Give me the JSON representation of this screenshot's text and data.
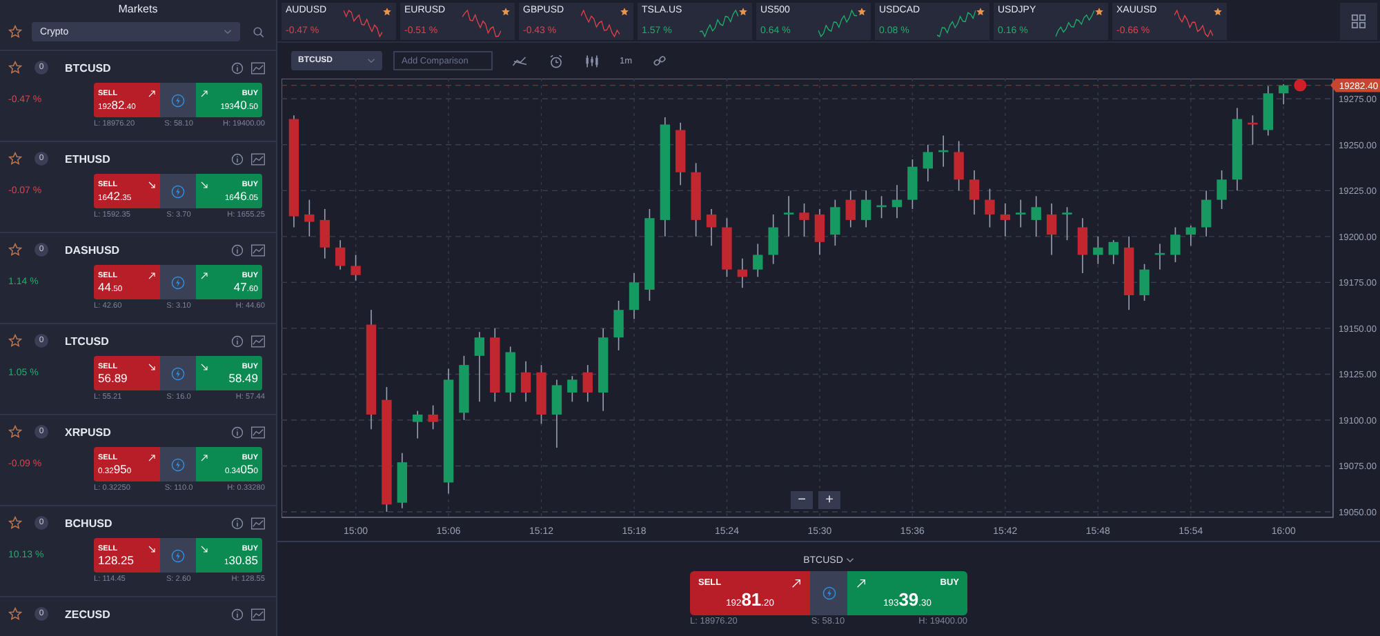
{
  "sidebar": {
    "title": "Markets",
    "filter": "Crypto",
    "markets": [
      {
        "name": "BTCUSD",
        "badge": "0",
        "change": "-0.47 %",
        "color": "#e0414a",
        "kind": "rising",
        "sell_label": "SELL",
        "buy_label": "BUY",
        "sell": {
          "pre": "192",
          "big": "82",
          "post": ".40"
        },
        "buy": {
          "pre": "193",
          "big": "40",
          "post": ".50"
        },
        "low": "L: 18976.20",
        "spread": "S: 58.10",
        "high": "H: 19400.00"
      },
      {
        "name": "ETHUSD",
        "badge": "0",
        "change": "-0.07 %",
        "color": "#e0414a",
        "kind": "falling",
        "sell_label": "SELL",
        "buy_label": "BUY",
        "sell": {
          "pre": "16",
          "big": "42",
          "post": ".35"
        },
        "buy": {
          "pre": "16",
          "big": "46",
          "post": ".05"
        },
        "low": "L: 1592.35",
        "spread": "S: 3.70",
        "high": "H: 1655.25"
      },
      {
        "name": "DASHUSD",
        "badge": "0",
        "change": "1.14 %",
        "color": "#1fae6b",
        "kind": "rising",
        "sell_label": "SELL",
        "buy_label": "BUY",
        "sell": {
          "big": "44",
          "post": ".50"
        },
        "buy": {
          "big": "47",
          "post": ".60"
        },
        "low": "L: 42.60",
        "spread": "S: 3.10",
        "high": "H: 44.60"
      },
      {
        "name": "LTCUSD",
        "badge": "0",
        "change": "1.05 %",
        "color": "#1fae6b",
        "kind": "falling",
        "sell_label": "SELL",
        "buy_label": "BUY",
        "sell": {
          "big": "56.89"
        },
        "buy": {
          "big": "58.49"
        },
        "low": "L: 55.21",
        "spread": "S: 16.0",
        "high": "H: 57.44"
      },
      {
        "name": "XRPUSD",
        "badge": "0",
        "change": "-0.09 %",
        "color": "#e0414a",
        "kind": "rising",
        "sell_label": "SELL",
        "buy_label": "BUY",
        "sell": {
          "pre": "0.32",
          "big": "95",
          "post": "0"
        },
        "buy": {
          "pre": "0.34",
          "big": "05",
          "post": "0"
        },
        "low": "L: 0.32250",
        "spread": "S: 110.0",
        "high": "H: 0.33280"
      },
      {
        "name": "BCHUSD",
        "badge": "0",
        "change": "10.13 %",
        "color": "#1fae6b",
        "kind": "falling",
        "sell_label": "SELL",
        "buy_label": "BUY",
        "sell": {
          "big": "128.25"
        },
        "buy": {
          "pre": "1",
          "big": "30.85"
        },
        "low": "L: 114.45",
        "spread": "S: 2.60",
        "high": "H: 128.55"
      },
      {
        "name": "ZECUSD",
        "badge": "0"
      }
    ]
  },
  "tickers": [
    {
      "name": "AUDUSD",
      "change": "-0.47 %",
      "color": "#e0414a",
      "kind": "falling"
    },
    {
      "name": "EURUSD",
      "change": "-0.51 %",
      "color": "#e0414a",
      "kind": "falling"
    },
    {
      "name": "GBPUSD",
      "change": "-0.43 %",
      "color": "#e0414a",
      "kind": "falling"
    },
    {
      "name": "TSLA.US",
      "change": "1.57 %",
      "color": "#1fae6b",
      "kind": "rising"
    },
    {
      "name": "US500",
      "change": "0.64 %",
      "color": "#1fae6b",
      "kind": "rising"
    },
    {
      "name": "USDCAD",
      "change": "0.08 %",
      "color": "#1fae6b",
      "kind": "rising"
    },
    {
      "name": "USDJPY",
      "change": "0.16 %",
      "color": "#1fae6b",
      "kind": "rising"
    },
    {
      "name": "XAUUSD",
      "change": "-0.66 %",
      "color": "#e0414a",
      "kind": "falling"
    }
  ],
  "toolbar": {
    "symbol": "BTCUSD",
    "comparison_placeholder": "Add Comparison",
    "interval": "1m"
  },
  "chart": {
    "zoom_controls": [
      "−",
      "+"
    ],
    "chart_data": {
      "type": "candlestick",
      "grid": true,
      "categories": [
        null,
        null,
        null,
        null,
        "15:00",
        null,
        null,
        null,
        null,
        null,
        "15:06",
        null,
        null,
        null,
        null,
        null,
        "15:12",
        null,
        null,
        null,
        null,
        null,
        "15:18",
        null,
        null,
        null,
        null,
        null,
        "15:24",
        null,
        null,
        null,
        null,
        null,
        "15:30",
        null,
        null,
        null,
        null,
        null,
        "15:36",
        null,
        null,
        null,
        null,
        null,
        "15:42",
        null,
        null,
        null,
        null,
        null,
        "15:48",
        null,
        null,
        null,
        null,
        null,
        "15:54",
        null,
        null,
        null,
        null,
        null,
        "16:00"
      ],
      "ylim": [
        19047,
        19286
      ],
      "yticks": [
        {
          "value": 19050,
          "label": "19050.00"
        },
        {
          "value": 19075,
          "label": "19075.00"
        },
        {
          "value": 19100,
          "label": "19100.00"
        },
        {
          "value": 19125,
          "label": "19125.00"
        },
        {
          "value": 19150,
          "label": "19150.00"
        },
        {
          "value": 19175,
          "label": "19175.00"
        },
        {
          "value": 19200,
          "label": "19200.00"
        },
        {
          "value": 19225,
          "label": "19225.00"
        },
        {
          "value": 19250,
          "label": "19250.00"
        },
        {
          "value": 19275,
          "label": "19275.00"
        }
      ],
      "ref_lines": [
        {
          "axis": "y",
          "value": 19282.4,
          "label": "19282.40"
        }
      ],
      "series": [
        {
          "ohlc": [
            [
              19264,
              19266,
              19205,
              19211
            ],
            [
              19212,
              19220,
              19200,
              19208
            ],
            [
              19209,
              19215,
              19188,
              19194
            ],
            [
              19194,
              19198,
              19182,
              19184
            ],
            [
              19184,
              19190,
              19176,
              19179
            ],
            [
              19152,
              19160,
              19095,
              19103
            ],
            [
              19111,
              19118,
              19050,
              19054
            ],
            [
              19055,
              19082,
              19052,
              19077
            ],
            [
              19099,
              19105,
              19090,
              19103
            ],
            [
              19103,
              19108,
              19095,
              19099
            ],
            [
              19066,
              19128,
              19060,
              19122
            ],
            [
              19104,
              19135,
              19100,
              19130
            ],
            [
              19135,
              19148,
              19110,
              19145
            ],
            [
              19145,
              19150,
              19110,
              19115
            ],
            [
              19115,
              19140,
              19110,
              19137
            ],
            [
              19126,
              19132,
              19110,
              19115
            ],
            [
              19126,
              19130,
              19098,
              19103
            ],
            [
              19103,
              19122,
              19085,
              19119
            ],
            [
              19115,
              19124,
              19110,
              19122
            ],
            [
              19126,
              19130,
              19110,
              19115
            ],
            [
              19115,
              19150,
              19105,
              19145
            ],
            [
              19145,
              19165,
              19138,
              19160
            ],
            [
              19160,
              19180,
              19155,
              19175
            ],
            [
              19171,
              19215,
              19165,
              19210
            ],
            [
              19209,
              19265,
              19200,
              19261
            ],
            [
              19258,
              19262,
              19228,
              19235
            ],
            [
              19235,
              19240,
              19200,
              19209
            ],
            [
              19212,
              19215,
              19195,
              19205
            ],
            [
              19205,
              19210,
              19178,
              19182
            ],
            [
              19182,
              19188,
              19172,
              19178
            ],
            [
              19182,
              19196,
              19178,
              19190
            ],
            [
              19190,
              19212,
              19185,
              19205
            ],
            [
              19212,
              19222,
              19200,
              19213
            ],
            [
              19213,
              19218,
              19200,
              19209
            ],
            [
              19212,
              19215,
              19190,
              19197
            ],
            [
              19201,
              19220,
              19195,
              19216
            ],
            [
              19220,
              19225,
              19205,
              19209
            ],
            [
              19209,
              19225,
              19205,
              19220
            ],
            [
              19216,
              19222,
              19210,
              19217
            ],
            [
              19216,
              19228,
              19210,
              19220
            ],
            [
              19220,
              19242,
              19215,
              19238
            ],
            [
              19237,
              19250,
              19230,
              19246
            ],
            [
              19246,
              19255,
              19238,
              19247
            ],
            [
              19246,
              19252,
              19225,
              19231
            ],
            [
              19231,
              19236,
              19212,
              19220
            ],
            [
              19220,
              19226,
              19205,
              19212
            ],
            [
              19212,
              19218,
              19200,
              19209
            ],
            [
              19212,
              19220,
              19205,
              19213
            ],
            [
              19209,
              19222,
              19200,
              19216
            ],
            [
              19212,
              19218,
              19190,
              19201
            ],
            [
              19212,
              19216,
              19198,
              19213
            ],
            [
              19205,
              19210,
              19180,
              19190
            ],
            [
              19190,
              19200,
              19185,
              19194
            ],
            [
              19190,
              19198,
              19185,
              19197
            ],
            [
              19194,
              19200,
              19160,
              19168
            ],
            [
              19168,
              19185,
              19165,
              19182
            ],
            [
              19190,
              19196,
              19182,
              19191
            ],
            [
              19190,
              19205,
              19186,
              19201
            ],
            [
              19201,
              19206,
              19195,
              19205
            ],
            [
              19205,
              19225,
              19200,
              19220
            ],
            [
              19220,
              19236,
              19215,
              19231
            ],
            [
              19231,
              19270,
              19225,
              19264
            ],
            [
              19262,
              19266,
              19250,
              19261
            ],
            [
              19258,
              19282,
              19255,
              19278
            ],
            [
              19278,
              19283,
              19272,
              19282.4
            ]
          ]
        }
      ]
    }
  },
  "trade_panel": {
    "symbol": "BTCUSD",
    "sell_label": "SELL",
    "buy_label": "BUY",
    "kind": "rising",
    "sell": {
      "pre": "192",
      "big": "81",
      "post": ".20"
    },
    "buy": {
      "pre": "193",
      "big": "39",
      "post": ".30"
    },
    "low": "L: 18976.20",
    "spread": "S: 58.10",
    "high": "H: 19400.00"
  }
}
